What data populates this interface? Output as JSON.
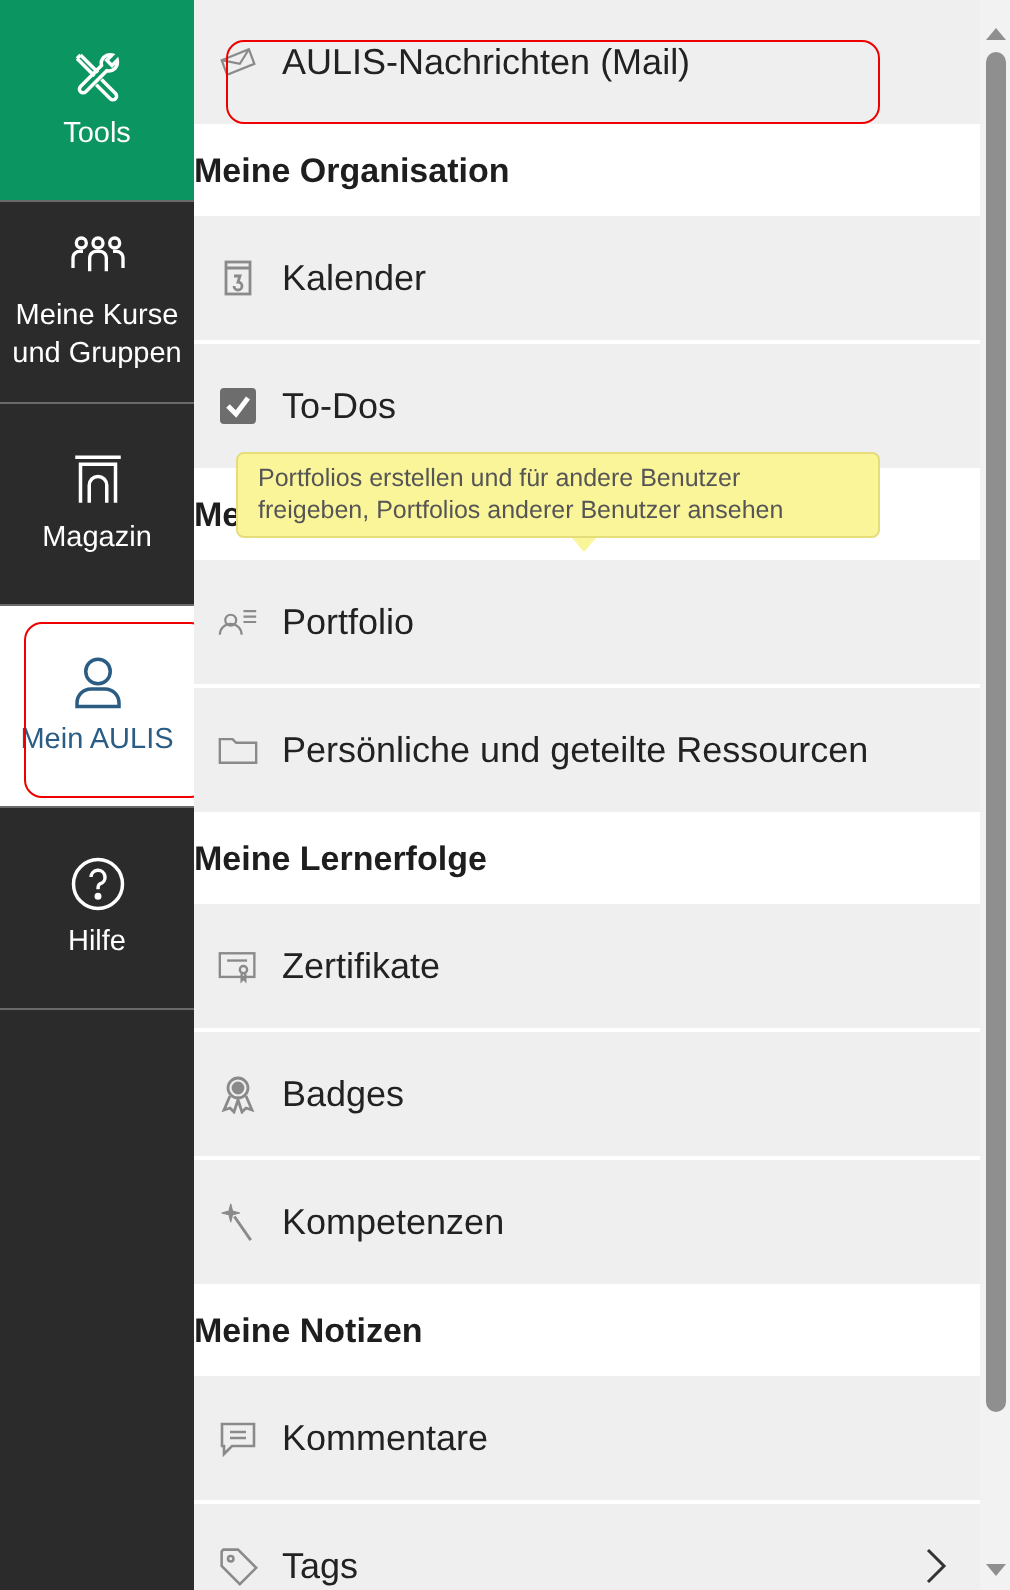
{
  "nav": [
    {
      "label": "Tools",
      "selected": false,
      "accent": true,
      "annotated": false
    },
    {
      "label": "Meine Kurse und Gruppen",
      "selected": false,
      "accent": false,
      "annotated": false
    },
    {
      "label": "Magazin",
      "selected": false,
      "accent": false,
      "annotated": false
    },
    {
      "label": "Mein AULIS",
      "selected": true,
      "accent": false,
      "annotated": true
    },
    {
      "label": "Hilfe",
      "selected": false,
      "accent": false,
      "annotated": false
    }
  ],
  "menu": [
    {
      "kind": "item",
      "label": "AULIS-Nachrichten (Mail)",
      "annotated": true,
      "submenu": false
    },
    {
      "kind": "heading",
      "label": "Meine Organisation"
    },
    {
      "kind": "item",
      "label": "Kalender",
      "annotated": false,
      "submenu": false
    },
    {
      "kind": "item",
      "label": "To-Dos",
      "annotated": false,
      "submenu": false
    },
    {
      "kind": "heading",
      "label": "Me"
    },
    {
      "kind": "item",
      "label": "Portfolio",
      "annotated": false,
      "submenu": false
    },
    {
      "kind": "item",
      "label": "Persönliche und geteilte Ressourcen",
      "annotated": false,
      "submenu": false
    },
    {
      "kind": "heading",
      "label": "Meine Lernerfolge"
    },
    {
      "kind": "item",
      "label": "Zertifikate",
      "annotated": false,
      "submenu": false
    },
    {
      "kind": "item",
      "label": "Badges",
      "annotated": false,
      "submenu": false
    },
    {
      "kind": "item",
      "label": "Kompetenzen",
      "annotated": false,
      "submenu": false
    },
    {
      "kind": "heading",
      "label": "Meine Notizen"
    },
    {
      "kind": "item",
      "label": "Kommentare",
      "annotated": false,
      "submenu": false
    },
    {
      "kind": "item",
      "label": "Tags",
      "annotated": false,
      "submenu": true
    }
  ],
  "tooltip": {
    "text": "Portfolios erstellen und für andere Benutzer freigeben, Portfolios anderer Benutzer ansehen"
  }
}
